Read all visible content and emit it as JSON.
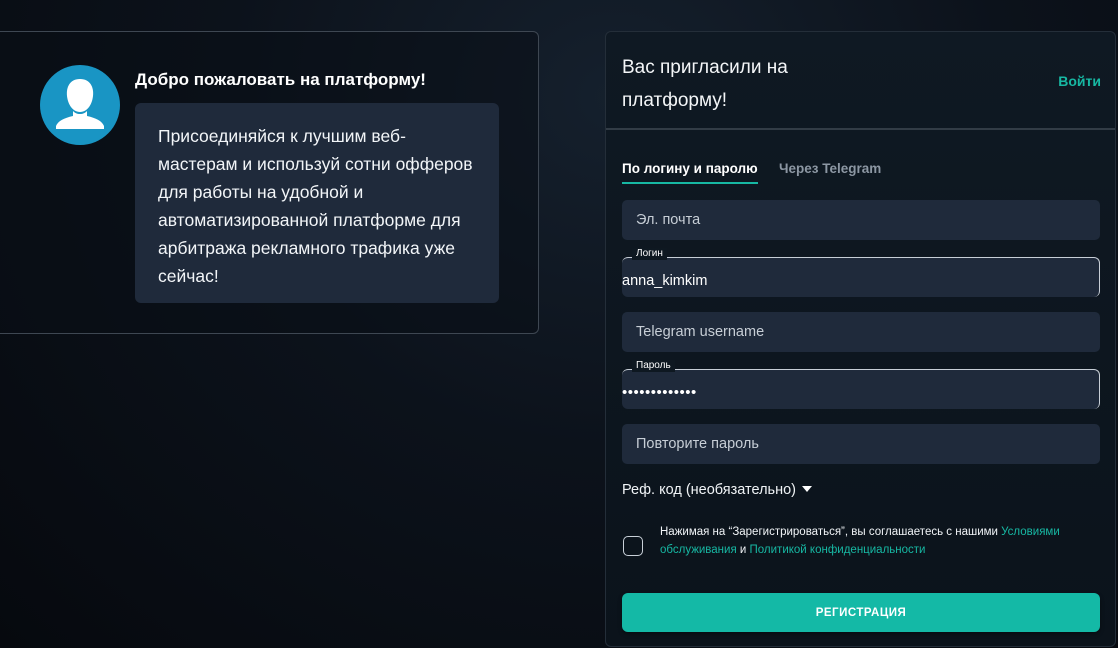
{
  "welcome": {
    "avatar_icon": "user-silhouette-icon",
    "title": "Добро пожаловать на платформу!",
    "message": "Присоединяйся к лучшим веб-мастерам и используй сотни офферов для работы на удобной и автоматизированной платформе для арбитража рекламного трафика уже сейчас!"
  },
  "register": {
    "title": "Вас пригласили на платформу!",
    "login_link": "Войти",
    "tabs": [
      {
        "label": "По логину и паролю",
        "active": true
      },
      {
        "label": "Через Telegram",
        "active": false
      }
    ],
    "fields": {
      "email": {
        "placeholder": "Эл. почта",
        "value": ""
      },
      "login": {
        "label": "Логин",
        "value": "anna_kimkim"
      },
      "telegram": {
        "placeholder": "Telegram username",
        "value": ""
      },
      "password": {
        "label": "Пароль",
        "value": "•••••••••••••"
      },
      "repeat_password": {
        "placeholder": "Повторите пароль",
        "value": ""
      }
    },
    "ref_code_label": "Реф. код (необязательно)",
    "terms": {
      "prefix": "Нажимая на “Зарегистрироваться”, вы соглашаетесь с нашими ",
      "terms_link": "Условиями обслуживания",
      "conjunction": " и ",
      "privacy_link": "Политикой конфиденциальности"
    },
    "submit_label": "РЕГИСТРАЦИЯ"
  },
  "colors": {
    "accent": "#14b9a6",
    "field_bg": "#1f2a3b",
    "avatar_bg": "#1995c4"
  }
}
